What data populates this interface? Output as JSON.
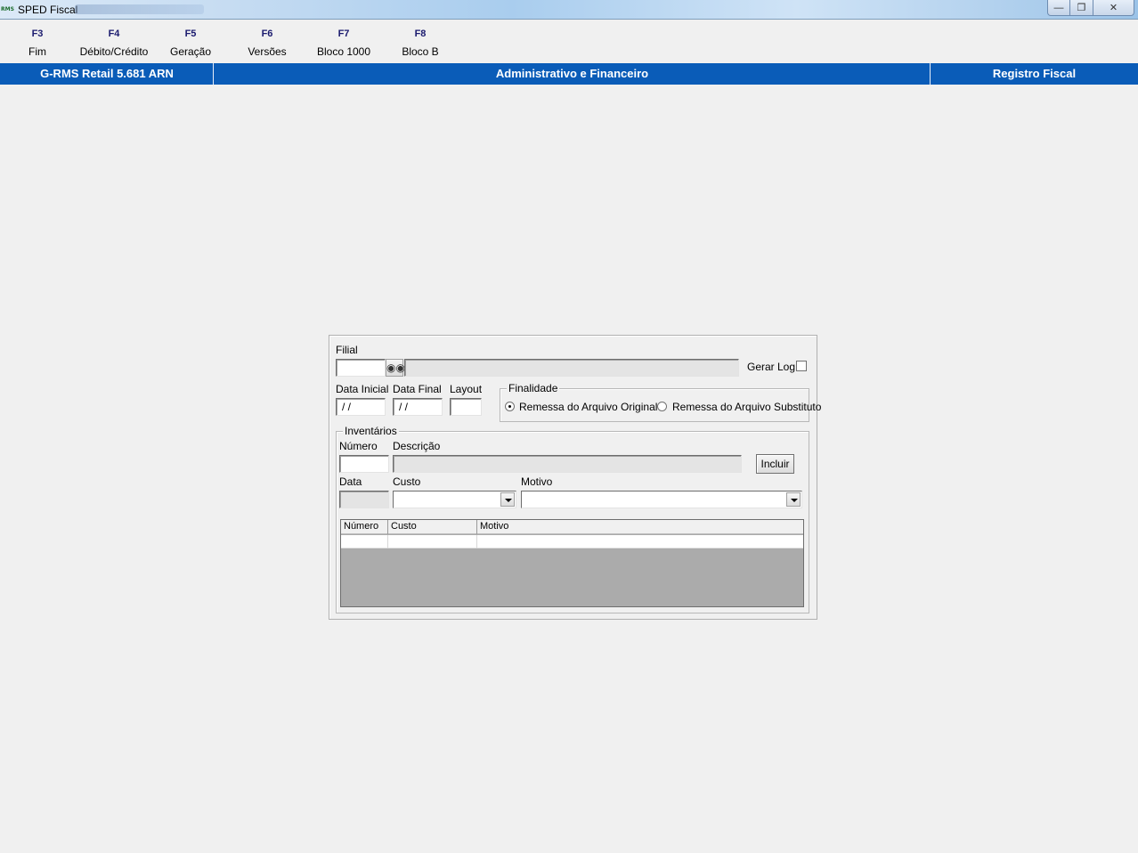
{
  "window": {
    "title": "SPED Fiscal",
    "app_logo_text": "RMS"
  },
  "toolbar": {
    "items": [
      {
        "key": "F3",
        "label": "Fim"
      },
      {
        "key": "F4",
        "label": "Débito/Crédito"
      },
      {
        "key": "F5",
        "label": "Geração"
      },
      {
        "key": "F6",
        "label": "Versões"
      },
      {
        "key": "F7",
        "label": "Bloco 1000"
      },
      {
        "key": "F8",
        "label": "Bloco B"
      }
    ]
  },
  "infobar": {
    "product": "G-RMS Retail 5.681 ARN",
    "module": "Administrativo e Financeiro",
    "screen": "Registro Fiscal"
  },
  "form": {
    "filial_label": "Filial",
    "filial_value": "",
    "filial_desc": "",
    "gerar_log_label": "Gerar Log",
    "gerar_log_checked": false,
    "data_inicial_label": "Data Inicial",
    "data_inicial_value": " / /",
    "data_final_label": "Data Final",
    "data_final_value": " / /",
    "layout_label": "Layout",
    "layout_value": "",
    "finalidade": {
      "title": "Finalidade",
      "options": [
        {
          "label": "Remessa do Arquivo Original",
          "selected": true
        },
        {
          "label": "Remessa do Arquivo Substituto",
          "selected": false
        }
      ]
    },
    "inventarios": {
      "title": "Inventários",
      "numero_label": "Número",
      "numero_value": "",
      "descricao_label": "Descrição",
      "descricao_value": "",
      "incluir_label": "Incluir",
      "data_label": "Data",
      "data_value": "",
      "custo_label": "Custo",
      "custo_value": "",
      "motivo_label": "Motivo",
      "motivo_value": "",
      "grid": {
        "columns": [
          "Número",
          "Custo",
          "Motivo"
        ]
      }
    }
  }
}
